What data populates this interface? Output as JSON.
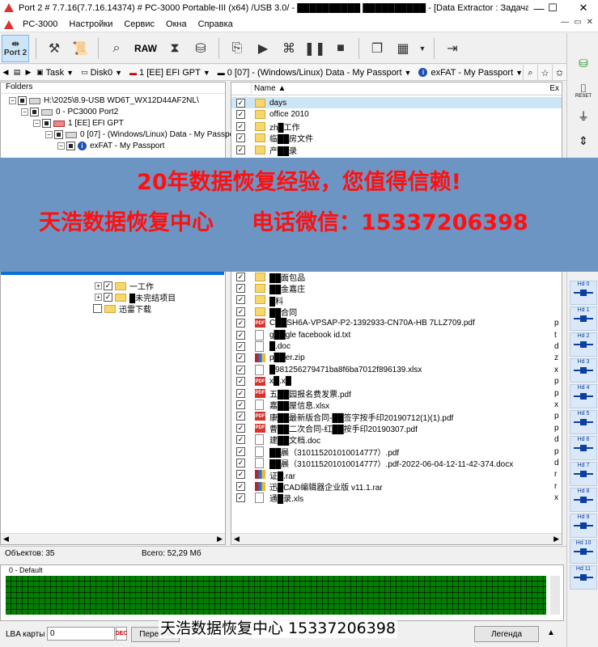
{
  "window": {
    "title": "Port 2 # 7.7.16(7.7.16.14374) # PC-3000 Portable-III (x64) /USB 3.0/ - ██████████ ██████████ - [Data Extractor : Задача - \"H:\\2025\\8.9-",
    "min": "—",
    "max": "☐",
    "close": "✕"
  },
  "menu": [
    "PC-3000",
    "Настройки",
    "Сервис",
    "Окна",
    "Справка"
  ],
  "mdi": [
    "—",
    "▭",
    "✕"
  ],
  "toolbar": {
    "port_label": "Port 2",
    "raw_label": "RAW"
  },
  "pathbar": {
    "task": "Task",
    "disk": "Disk0",
    "partition1": "1 [EE] EFI GPT",
    "partition2": "0 [07] - (Windows/Linux) Data - My Passport",
    "partition3": "exFAT - My Passport"
  },
  "folders": {
    "header": "Folders",
    "tree": [
      {
        "label": "H:\\2025\\8.9-USB WD6T_WX12D44AF2NL\\",
        "type": "disk",
        "indent": 1
      },
      {
        "label": "0 - PC3000 Port2",
        "type": "disk",
        "indent": 2
      },
      {
        "label": "1 [EE] EFI GPT",
        "type": "disk",
        "indent": 3
      },
      {
        "label": "0 [07] - (Windows/Linux) Data - My Passport",
        "type": "disk",
        "indent": 4
      },
      {
        "label": "exFAT - My Passport",
        "type": "info",
        "indent": 5
      }
    ],
    "tree_lower": [
      {
        "label": "一工作",
        "type": "folder",
        "indent": 7
      },
      {
        "label": "█未完结项目",
        "type": "folder",
        "indent": 7
      },
      {
        "label": "迅雷下载",
        "type": "folder",
        "indent": 6
      }
    ]
  },
  "files": {
    "name_col": "Name",
    "ext_col": "Ex",
    "rows": [
      {
        "name": "days",
        "icon": "folder",
        "ext": ""
      },
      {
        "name": "office 2010",
        "icon": "folder",
        "ext": ""
      },
      {
        "name": "zh█工作",
        "icon": "folder",
        "ext": ""
      },
      {
        "name": "临██房文件",
        "icon": "folder",
        "ext": ""
      },
      {
        "name": "产██录",
        "icon": "folder",
        "ext": ""
      }
    ],
    "rows_lower": [
      {
        "name": "██面包品",
        "icon": "folder",
        "ext": ""
      },
      {
        "name": "██金嘉庄",
        "icon": "folder",
        "ext": ""
      },
      {
        "name": "█料",
        "icon": "folder",
        "ext": ""
      },
      {
        "name": "██合同",
        "icon": "folder",
        "ext": ""
      },
      {
        "name": "C██SH6A-VPSAP-P2-1392933-CN70A-HB 7LLZ709.pdf",
        "icon": "pdf",
        "ext": "p"
      },
      {
        "name": "g██gle facebook id.txt",
        "icon": "doc",
        "ext": "t"
      },
      {
        "name": "█.doc",
        "icon": "doc",
        "ext": "d"
      },
      {
        "name": "p██er.zip",
        "icon": "zip",
        "ext": "z"
      },
      {
        "name": "█981256279471ba8f6ba7012f896139.xlsx",
        "icon": "doc",
        "ext": "x"
      },
      {
        "name": "x█.x█",
        "icon": "pdf",
        "ext": "p"
      },
      {
        "name": "五██园报名费发票.pdf",
        "icon": "pdf",
        "ext": "p"
      },
      {
        "name": "嘉██屋信息.xlsx",
        "icon": "doc",
        "ext": "x"
      },
      {
        "name": "康██最新版合同-██签字按手印20190712(1)(1).pdf",
        "icon": "pdf",
        "ext": "p"
      },
      {
        "name": "曹██二次合同-红██按手印20190307.pdf",
        "icon": "pdf",
        "ext": "p"
      },
      {
        "name": "建██文档.doc",
        "icon": "doc",
        "ext": "d"
      },
      {
        "name": "██晨（310115201010014777）.pdf",
        "icon": "doc",
        "ext": "p"
      },
      {
        "name": "██晨（310115201010014777）.pdf-2022-06-04-12-11-42-374.docx",
        "icon": "doc",
        "ext": "d"
      },
      {
        "name": "证█.rar",
        "icon": "zip",
        "ext": "r"
      },
      {
        "name": "迅█CAD编辑器企业版 v11.1.rar",
        "icon": "zip",
        "ext": "r"
      },
      {
        "name": "通█录.xls",
        "icon": "doc",
        "ext": "x"
      }
    ]
  },
  "status": {
    "objects": "Объектов: 35",
    "total": "Всего: 52,29 Мб"
  },
  "map": {
    "label": "0 - Default"
  },
  "bottom": {
    "lba_label": "LBA карты",
    "lba_value": "0",
    "dec_label": "DEC",
    "go_button": "Перейти",
    "legend_button": "Легенда"
  },
  "side": {
    "reset_label": "RESET",
    "hd_buttons": [
      "Hd 0",
      "Hd 1",
      "Hd 2",
      "Hd 3",
      "Hd 4",
      "Hd 5",
      "Hd 6",
      "Hd 7",
      "Hd 8",
      "Hd 9",
      "Hd 10",
      "Hd 11"
    ]
  },
  "banner": {
    "line1": "20年数据恢复经验，您值得信赖!",
    "line2": "天浩数据恢复中心     电话微信：15337206398"
  },
  "watermark": "天浩数据恢复中心 15337206398"
}
